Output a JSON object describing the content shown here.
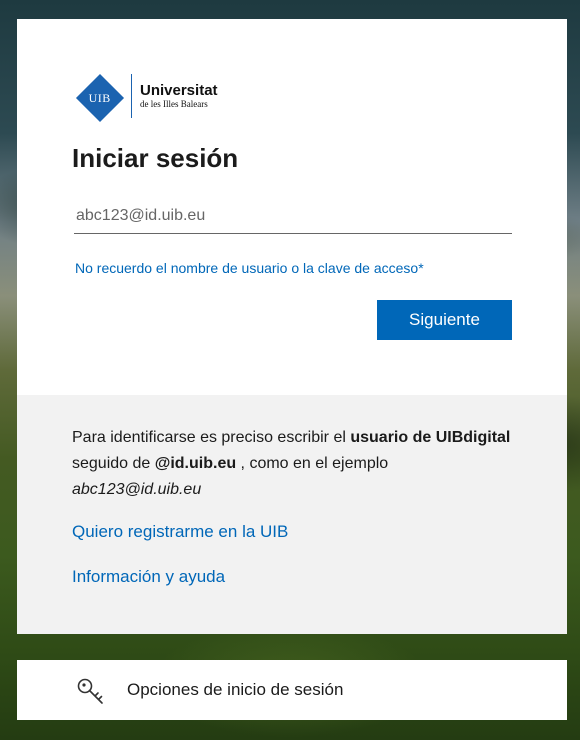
{
  "logo": {
    "monogram": "UIB",
    "name": "Universitat",
    "subname": "de les Illes Balears"
  },
  "login": {
    "title": "Iniciar sesión",
    "email_placeholder": "abc123@id.uib.eu",
    "email_value": "",
    "forgot_link": "No recuerdo el nombre de usuario o la clave de acceso*",
    "next_button": "Siguiente"
  },
  "info": {
    "part1": "Para identificarse es preciso escribir el ",
    "bold1": "usuario de UIBdigital",
    "part2": " seguido de ",
    "bold2": "@id.uib.eu",
    "part3": " , como en el ejemplo ",
    "italic_example": "abc123@id.uib.eu",
    "register_link": "Quiero registrarme en la UIB",
    "help_link": "Información y ayuda"
  },
  "options": {
    "icon": "key-icon",
    "label": "Opciones de inicio de sesión"
  },
  "colors": {
    "accent": "#0067b8",
    "brand": "#1b63b0"
  }
}
